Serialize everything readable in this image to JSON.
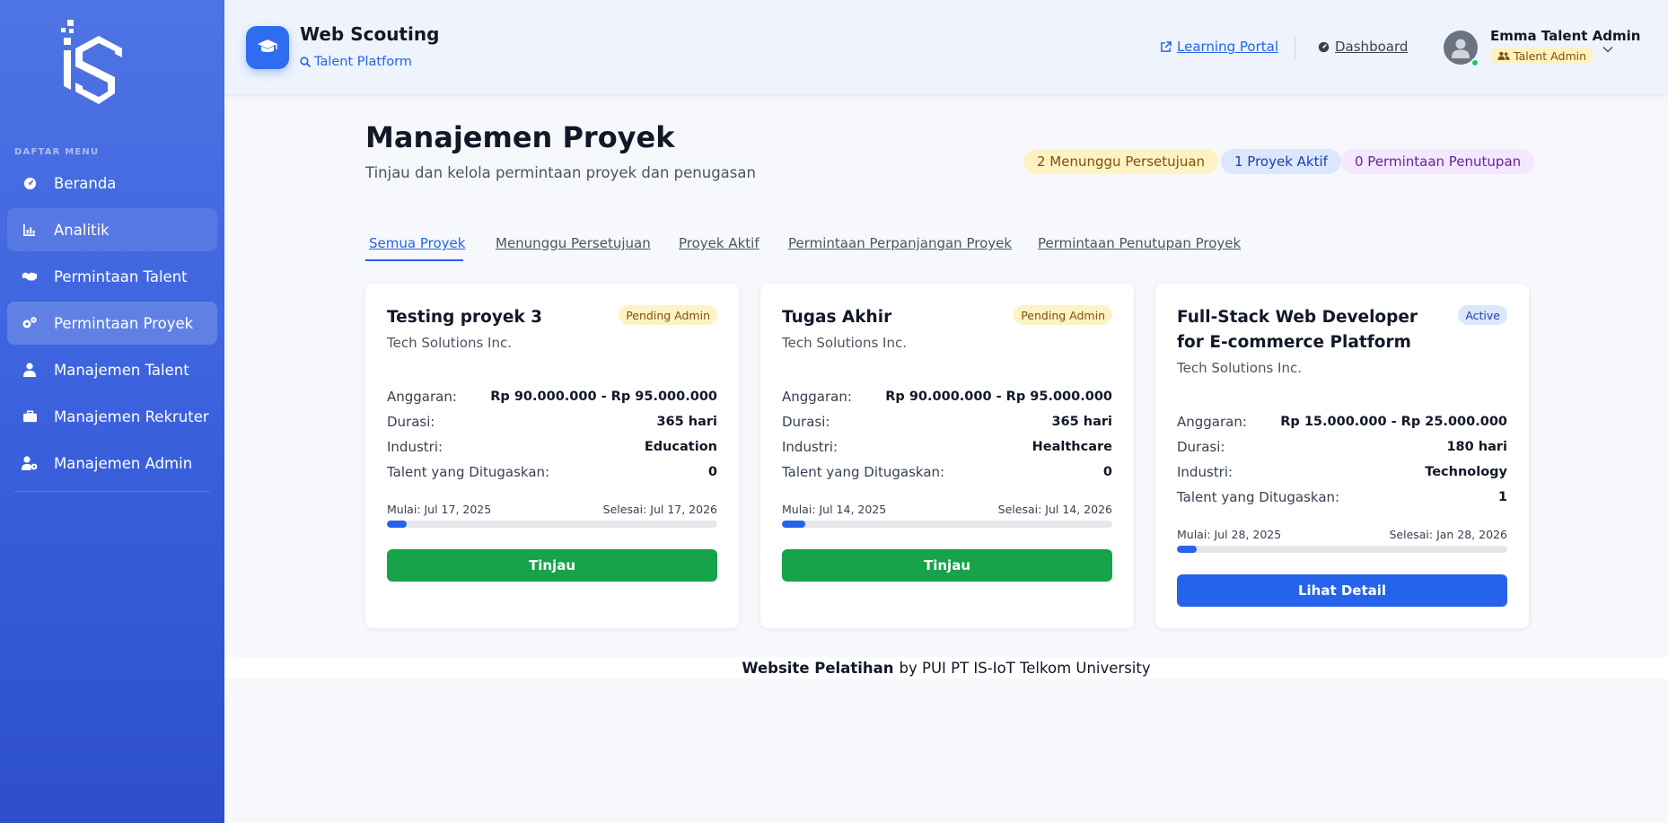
{
  "sidebar": {
    "menu_title": "DAFTAR MENU",
    "items": [
      {
        "label": "Beranda",
        "icon": "gauge-icon"
      },
      {
        "label": "Analitik",
        "icon": "chart-icon"
      },
      {
        "label": "Permintaan Talent",
        "icon": "handshake-icon"
      },
      {
        "label": "Permintaan Proyek",
        "icon": "cogs-icon"
      },
      {
        "label": "Manajemen Talent",
        "icon": "user-tie-icon"
      },
      {
        "label": "Manajemen Rekruter",
        "icon": "briefcase-icon"
      },
      {
        "label": "Manajemen Admin",
        "icon": "user-cog-icon"
      }
    ]
  },
  "header": {
    "brand_title": "Web Scouting",
    "brand_sub": "Talent Platform",
    "learning_portal": "Learning Portal",
    "dashboard": "Dashboard",
    "user_name": "Emma Talent Admin",
    "user_role": "Talent Admin"
  },
  "main": {
    "title": "Manajemen Proyek",
    "subtitle": "Tinjau dan kelola permintaan proyek dan penugasan",
    "stats": {
      "pending": "2 Menunggu Persetujuan",
      "active": "1 Proyek Aktif",
      "closing": "0 Permintaan Penutupan"
    },
    "tabs": [
      "Semua Proyek",
      "Menunggu Persetujuan",
      "Proyek Aktif",
      "Permintaan Perpanjangan Proyek",
      "Permintaan Penutupan Proyek"
    ],
    "labels": {
      "budget": "Anggaran:",
      "duration": "Durasi:",
      "industry": "Industri:",
      "talent": "Talent yang Ditugaskan:"
    },
    "cards": [
      {
        "title": "Testing proyek 3",
        "badge": "Pending Admin",
        "company": "Tech Solutions Inc.",
        "budget": "Rp 90.000.000 - Rp 95.000.000",
        "duration": "365 hari",
        "industry": "Education",
        "talent": "0",
        "start": "Mulai: Jul 17, 2025",
        "end": "Selesai: Jul 17, 2026",
        "progress": 0.06,
        "button": "Tinjau"
      },
      {
        "title": "Tugas Akhir",
        "badge": "Pending Admin",
        "company": "Tech Solutions Inc.",
        "budget": "Rp 90.000.000 - Rp 95.000.000",
        "duration": "365 hari",
        "industry": "Healthcare",
        "talent": "0",
        "start": "Mulai: Jul 14, 2025",
        "end": "Selesai: Jul 14, 2026",
        "progress": 0.07,
        "button": "Tinjau"
      },
      {
        "title": "Full-Stack Web Developer for E-commerce Platform",
        "badge": "Active",
        "company": "Tech Solutions Inc.",
        "budget": "Rp 15.000.000 - Rp 25.000.000",
        "duration": "180 hari",
        "industry": "Technology",
        "talent": "1",
        "start": "Mulai: Jul 28, 2025",
        "end": "Selesai: Jan 28, 2026",
        "progress": 0.06,
        "button": "Lihat Detail"
      }
    ]
  },
  "footer": {
    "bold": "Website Pelatihan",
    "rest": "by PUI PT IS-IoT Telkom University"
  },
  "colors": {
    "primary": "#2563eb",
    "success": "#16a34a",
    "sidebar_top": "#4f74e3",
    "sidebar_bottom": "#2d4fce"
  }
}
